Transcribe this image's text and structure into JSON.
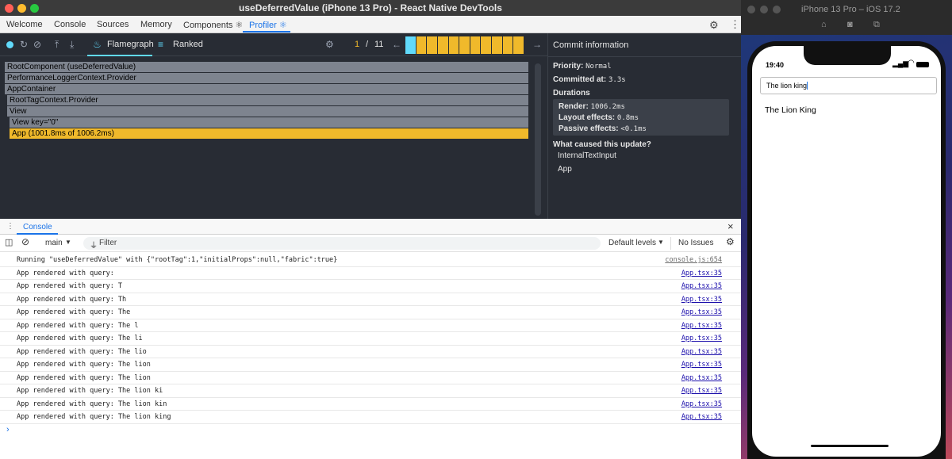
{
  "window": {
    "title": "useDeferredValue (iPhone 13 Pro) - React Native DevTools"
  },
  "tabs": [
    {
      "label": "Welcome"
    },
    {
      "label": "Console"
    },
    {
      "label": "Sources"
    },
    {
      "label": "Memory"
    },
    {
      "label": "Components ⚛"
    },
    {
      "label": "Profiler ⚛"
    }
  ],
  "profiler": {
    "tabs": {
      "flamegraph": "Flamegraph",
      "ranked": "Ranked"
    },
    "commit_counter": {
      "current": "1",
      "separator": "/",
      "total": "11"
    },
    "commits": {
      "count": 11,
      "selected_index": 0
    },
    "flame": [
      {
        "label": "RootComponent (useDeferredValue)",
        "depth": 0,
        "hot": false
      },
      {
        "label": "PerformanceLoggerContext.Provider",
        "depth": 0,
        "hot": false
      },
      {
        "label": "AppContainer",
        "depth": 0,
        "hot": false
      },
      {
        "label": "RootTagContext.Provider",
        "depth": 1,
        "hot": false
      },
      {
        "label": "View",
        "depth": 1,
        "hot": false
      },
      {
        "label": "View key=\"0\"",
        "depth": 2,
        "hot": false
      },
      {
        "label": "App (1001.8ms of 1006.2ms)",
        "depth": 2,
        "hot": true
      }
    ],
    "commit_info": {
      "heading": "Commit information",
      "priority_label": "Priority:",
      "priority_value": "Normal",
      "committed_label": "Committed at:",
      "committed_value": "3.3s",
      "durations_label": "Durations",
      "render_label": "Render:",
      "render_value": "1006.2ms",
      "layout_label": "Layout effects:",
      "layout_value": "0.8ms",
      "passive_label": "Passive effects:",
      "passive_value": "<0.1ms",
      "cause_heading": "What caused this update?",
      "causes": [
        "InternalTextInput",
        "App"
      ]
    }
  },
  "console": {
    "tab_label": "Console",
    "context": "main",
    "filter_placeholder": "Filter",
    "levels": "Default levels",
    "issues": "No Issues",
    "logs": [
      {
        "msg": "Running \"useDeferredValue\" with {\"rootTag\":1,\"initialProps\":null,\"fabric\":true}",
        "src": "console.js:654"
      },
      {
        "msg": "App rendered with query:",
        "src": "App.tsx:35"
      },
      {
        "msg": "App rendered with query: T",
        "src": "App.tsx:35"
      },
      {
        "msg": "App rendered with query: Th",
        "src": "App.tsx:35"
      },
      {
        "msg": "App rendered with query: The",
        "src": "App.tsx:35"
      },
      {
        "msg": "App rendered with query: The l",
        "src": "App.tsx:35"
      },
      {
        "msg": "App rendered with query: The li",
        "src": "App.tsx:35"
      },
      {
        "msg": "App rendered with query: The lio",
        "src": "App.tsx:35"
      },
      {
        "msg": "App rendered with query: The lion",
        "src": "App.tsx:35"
      },
      {
        "msg": "App rendered with query: The lion",
        "src": "App.tsx:35"
      },
      {
        "msg": "App rendered with query: The lion ki",
        "src": "App.tsx:35"
      },
      {
        "msg": "App rendered with query: The lion kin",
        "src": "App.tsx:35"
      },
      {
        "msg": "App rendered with query: The lion king",
        "src": "App.tsx:35"
      }
    ]
  },
  "simulator": {
    "title": "iPhone 13 Pro – iOS 17.2",
    "time": "19:40",
    "search_value": "The lion king",
    "result": "The Lion King"
  },
  "colors": {
    "accent": "#1a73e8",
    "react": "#61dafb",
    "flame_hot": "#f0b92b"
  }
}
